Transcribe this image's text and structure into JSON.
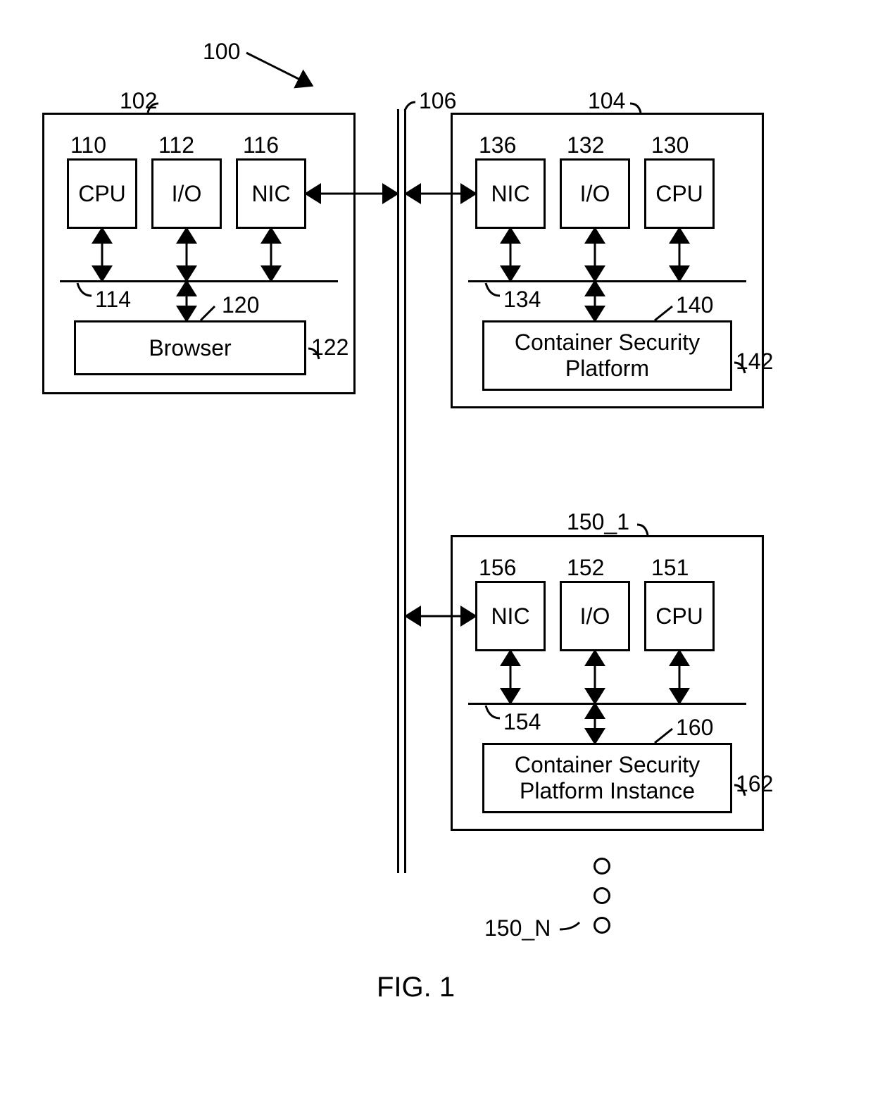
{
  "figure_caption": "FIG. 1",
  "overall_ref": "100",
  "modules": {
    "m102": {
      "ref": "102",
      "components": {
        "cpu": {
          "label": "CPU",
          "ref": "110"
        },
        "io": {
          "label": "I/O",
          "ref": "112"
        },
        "nic": {
          "label": "NIC",
          "ref": "116"
        },
        "bus_ref": "114",
        "app": {
          "label": "Browser",
          "ref_a": "120",
          "ref_b": "122"
        }
      }
    },
    "m104": {
      "ref": "104",
      "components": {
        "nic": {
          "label": "NIC",
          "ref": "136"
        },
        "io": {
          "label": "I/O",
          "ref": "132"
        },
        "cpu": {
          "label": "CPU",
          "ref": "130"
        },
        "bus_ref": "134",
        "app": {
          "label_l1": "Container Security",
          "label_l2": "Platform",
          "ref_a": "140",
          "ref_b": "142"
        }
      }
    },
    "m150": {
      "ref": "150_1",
      "components": {
        "nic": {
          "label": "NIC",
          "ref": "156"
        },
        "io": {
          "label": "I/O",
          "ref": "152"
        },
        "cpu": {
          "label": "CPU",
          "ref": "151"
        },
        "bus_ref": "154",
        "app": {
          "label_l1": "Container Security",
          "label_l2": "Platform Instance",
          "ref_a": "160",
          "ref_b": "162"
        }
      }
    }
  },
  "network_ref": "106",
  "ellipsis_ref": "150_N"
}
